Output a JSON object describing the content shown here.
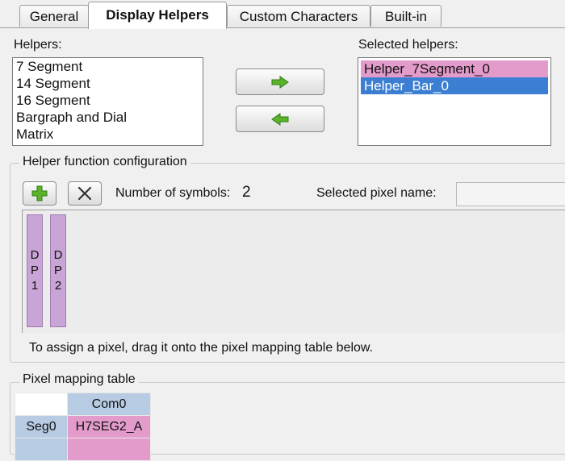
{
  "tabs": [
    "General",
    "Display Helpers",
    "Custom Characters",
    "Built-in"
  ],
  "helpers": {
    "label": "Helpers:",
    "items": [
      "7 Segment",
      "14 Segment",
      "16 Segment",
      "Bargraph and Dial",
      "Matrix"
    ]
  },
  "selected_helpers": {
    "label": "Selected helpers:",
    "items": [
      "Helper_7Segment_0",
      "Helper_Bar_0"
    ]
  },
  "buttons": {
    "add_icon": "arrow-right-icon",
    "remove_icon": "arrow-left-icon"
  },
  "config": {
    "title": "Helper function configuration",
    "symbols_label": "Number of symbols:",
    "symbols_value": "2",
    "pixel_name_label": "Selected pixel name:",
    "pixel_name_value": "",
    "pixels": [
      "DP1",
      "DP2"
    ],
    "hint": "To assign a pixel, drag it onto the pixel mapping table below."
  },
  "mapping": {
    "title": "Pixel mapping table",
    "column": "Com0",
    "row_label": "Seg0",
    "cell": "H7SEG2_A"
  },
  "colors": {
    "pink": "#e29bcb",
    "selection_blue": "#3c7fd2",
    "header_blue": "#b7cbe3",
    "purple": "#c9a4d6",
    "green_arrow": "#5bb32a"
  }
}
